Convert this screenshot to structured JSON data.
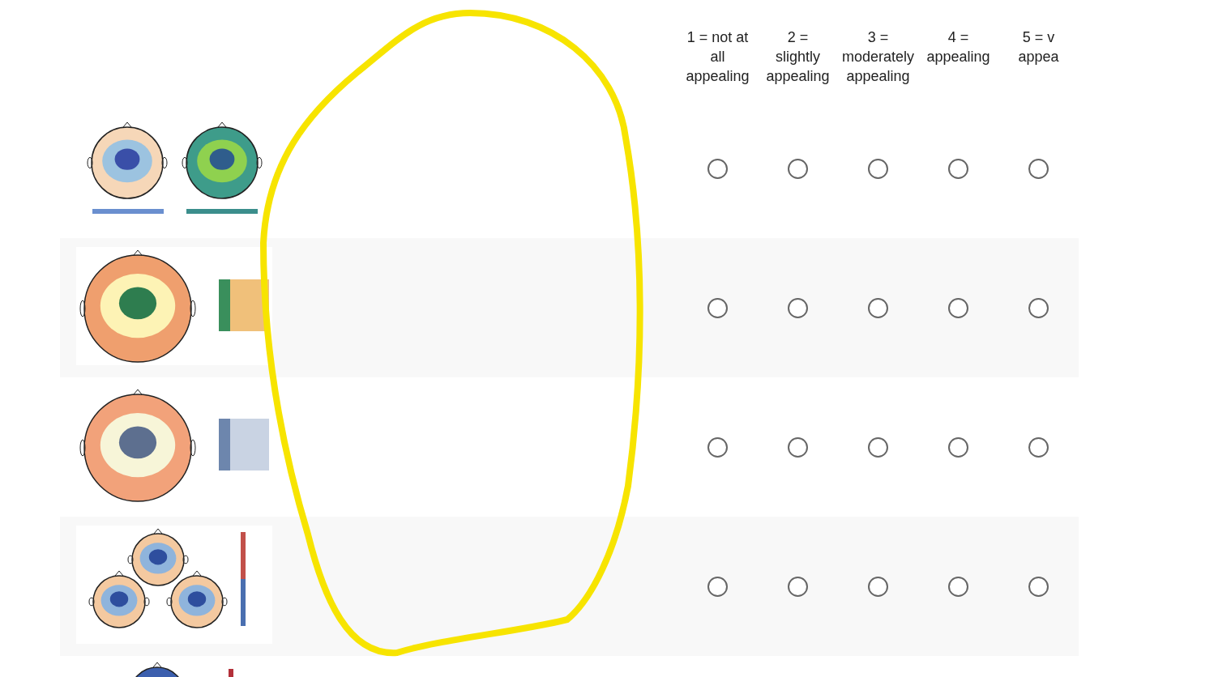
{
  "scale": [
    {
      "lines": [
        "1 = not at",
        "all",
        "appealing"
      ]
    },
    {
      "lines": [
        "2 =",
        "slightly",
        "appealing"
      ]
    },
    {
      "lines": [
        "3 =",
        "moderately",
        "appealing"
      ]
    },
    {
      "lines": [
        "4 =",
        "appealing"
      ]
    },
    {
      "lines": [
        "5 = v",
        "appea"
      ]
    }
  ],
  "rows": [
    {
      "image": {
        "kind": "picture"
      },
      "options": [
        {
          "selected": false
        },
        {
          "selected": false
        },
        {
          "selected": false
        },
        {
          "selected": false
        },
        {
          "selected": false
        }
      ]
    },
    {
      "image": {
        "kind": "picture"
      },
      "options": [
        {
          "selected": false
        },
        {
          "selected": false
        },
        {
          "selected": false
        },
        {
          "selected": false
        },
        {
          "selected": false
        }
      ]
    },
    {
      "image": {
        "kind": "picture"
      },
      "options": [
        {
          "selected": false
        },
        {
          "selected": false
        },
        {
          "selected": false
        },
        {
          "selected": false
        },
        {
          "selected": false
        }
      ]
    },
    {
      "image": {
        "kind": "picture"
      },
      "options": [
        {
          "selected": false
        },
        {
          "selected": false
        },
        {
          "selected": false
        },
        {
          "selected": false
        },
        {
          "selected": false
        }
      ]
    },
    {
      "image": {
        "kind": "picture"
      }
    }
  ],
  "annotation": {
    "kind": "loop"
  }
}
